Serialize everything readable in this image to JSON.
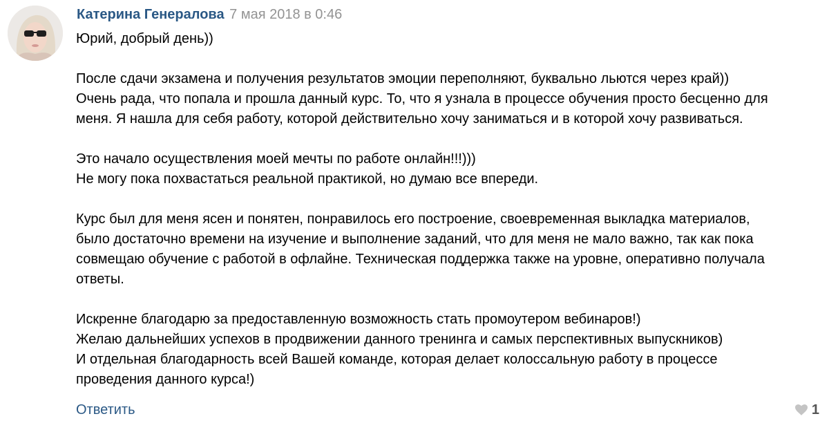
{
  "comment": {
    "author": "Катерина Генералова",
    "date": "7 мая 2018 в 0:46",
    "avatar_icon": "user-avatar-photo",
    "lines": [
      "Юрий, добрый день))",
      "",
      "После сдачи экзамена и получения результатов эмоции переполняют, буквально льются через край))",
      "Очень рада, что попала и прошла данный курс. То, что я узнала в процессе обучения просто бесценно для",
      "меня. Я нашла для себя работу, которой действительно хочу заниматься и в которой хочу развиваться.",
      "",
      "Это начало осуществления моей мечты по работе онлайн!!!)))",
      "Не могу пока похвастаться реальной практикой, но думаю все впереди.",
      "",
      "Курс был для меня ясен и понятен, понравилось его построение, своевременная выкладка материалов,",
      "было достаточно времени на изучение и выполнение заданий, что для меня не мало важно, так как пока",
      "совмещаю обучение с работой в офлайне. Техническая поддержка также на уровне, оперативно получала",
      "ответы.",
      "",
      "Искренне благодарю за предоставленную возможность стать промоутером вебинаров!)",
      "Желаю дальнейших успехов в продвижении данного тренинга и самых перспективных выпускников)",
      "И отдельная благодарность всей Вашей команде, которая делает колоссальную работу в процессе",
      "проведения данного курса!)"
    ],
    "reply_label": "Ответить",
    "like_icon": "heart-icon",
    "like_count": "1",
    "colors": {
      "link": "#2a5885",
      "meta": "#939393",
      "text": "#000000",
      "like_icon": "#c4c4c4"
    }
  }
}
